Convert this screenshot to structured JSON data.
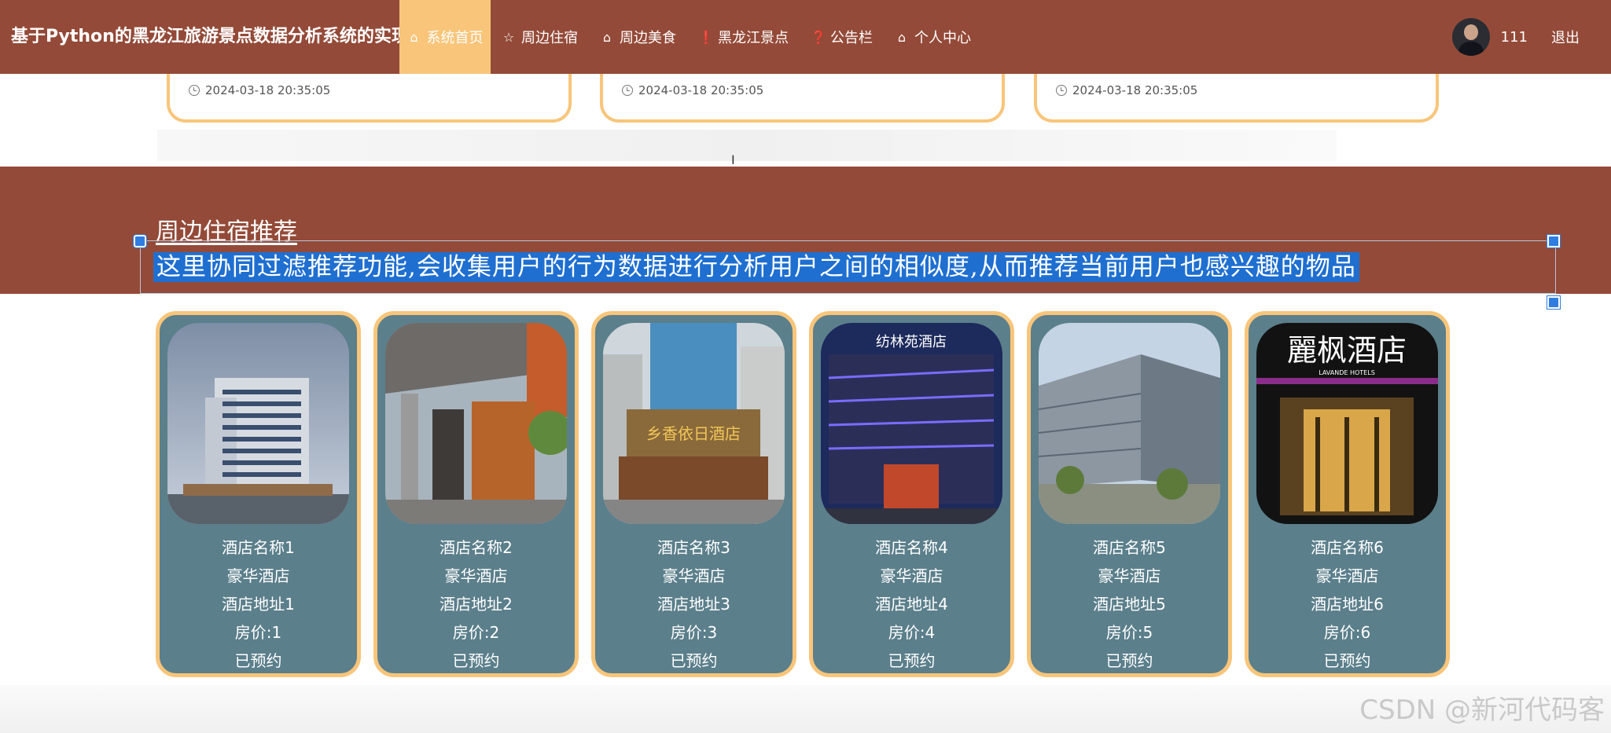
{
  "header": {
    "site_title": "基于Python的黑龙江旅游景点数据分析系统的实现",
    "nav": [
      {
        "label": "系统首页",
        "icon": "home-icon",
        "active": true
      },
      {
        "label": "周边住宿",
        "icon": "star-icon",
        "active": false
      },
      {
        "label": "周边美食",
        "icon": "bag-icon",
        "active": false
      },
      {
        "label": "黑龙江景点",
        "icon": "info-icon",
        "active": false
      },
      {
        "label": "公告栏",
        "icon": "question-icon",
        "active": false
      },
      {
        "label": "个人中心",
        "icon": "home-outline-icon",
        "active": false
      }
    ],
    "username": "111",
    "logout_label": "退出"
  },
  "news": [
    {
      "time": "2024-03-18 20:35:05"
    },
    {
      "time": "2024-03-18 20:35:05"
    },
    {
      "time": "2024-03-18 20:35:05"
    }
  ],
  "section": {
    "title": "周边住宿推荐",
    "description": "这里协同过滤推荐功能,会收集用户的行为数据进行分析用户之间的相似度,从而推荐当前用户也感兴趣的物品"
  },
  "hotels": [
    {
      "name": "酒店名称1",
      "type": "豪华酒店",
      "address": "酒店地址1",
      "price": "房价:1",
      "status": "已预约"
    },
    {
      "name": "酒店名称2",
      "type": "豪华酒店",
      "address": "酒店地址2",
      "price": "房价:2",
      "status": "已预约"
    },
    {
      "name": "酒店名称3",
      "type": "豪华酒店",
      "address": "酒店地址3",
      "price": "房价:3",
      "status": "已预约"
    },
    {
      "name": "酒店名称4",
      "type": "豪华酒店",
      "address": "酒店地址4",
      "price": "房价:4",
      "status": "已预约"
    },
    {
      "name": "酒店名称5",
      "type": "豪华酒店",
      "address": "酒店地址5",
      "price": "房价:5",
      "status": "已预约"
    },
    {
      "name": "酒店名称6",
      "type": "豪华酒店",
      "address": "酒店地址6",
      "price": "房价:6",
      "status": "已预约"
    }
  ],
  "hotel_image_text": {
    "hotel3_sign": "乡香依日酒店",
    "hotel4_sign": "纺林苑酒店",
    "hotel6_sign": "麗枫酒店",
    "hotel6_sub": "LAVANDE HOTELS"
  },
  "watermark": "CSDN @新河代码客",
  "colors": {
    "brand": "#944a38",
    "accent": "#f8c57a",
    "card_bg": "#5b7f8b",
    "selection": "#1f6fd1"
  }
}
